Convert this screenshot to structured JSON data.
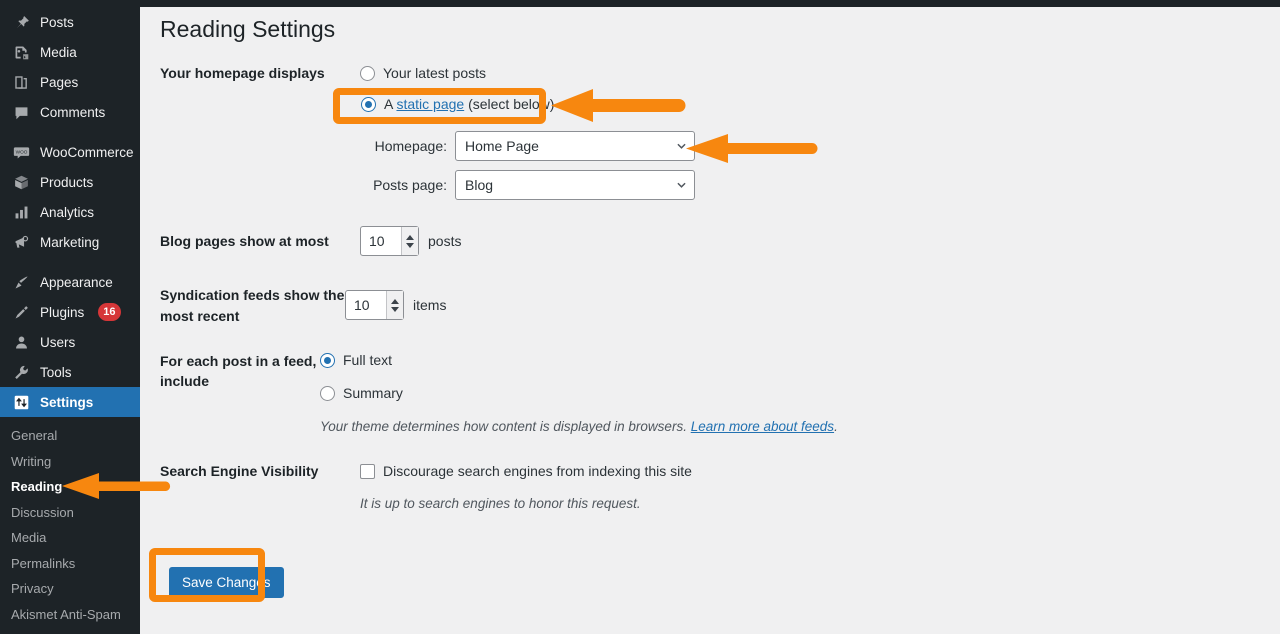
{
  "colors": {
    "sidebar_bg": "#1d2327",
    "accent_blue": "#2271b1",
    "highlight_orange": "#f7870f",
    "badge_red": "#d63638",
    "content_bg": "#f0f0f1"
  },
  "sidebar": {
    "items": [
      {
        "label": "Posts",
        "icon": "pin-icon",
        "separator_after": false
      },
      {
        "label": "Media",
        "icon": "media-icon",
        "separator_after": false
      },
      {
        "label": "Pages",
        "icon": "pages-icon",
        "separator_after": false
      },
      {
        "label": "Comments",
        "icon": "comment-icon",
        "separator_after": true
      },
      {
        "label": "WooCommerce",
        "icon": "woocommerce-icon",
        "separator_after": false
      },
      {
        "label": "Products",
        "icon": "products-icon",
        "separator_after": false
      },
      {
        "label": "Analytics",
        "icon": "analytics-icon",
        "separator_after": false
      },
      {
        "label": "Marketing",
        "icon": "marketing-icon",
        "separator_after": true
      },
      {
        "label": "Appearance",
        "icon": "appearance-icon",
        "separator_after": false
      },
      {
        "label": "Plugins",
        "icon": "plugins-icon",
        "badge": "16",
        "separator_after": false
      },
      {
        "label": "Users",
        "icon": "users-icon",
        "separator_after": false
      },
      {
        "label": "Tools",
        "icon": "tools-icon",
        "separator_after": false
      },
      {
        "label": "Settings",
        "icon": "settings-icon",
        "current": true,
        "separator_after": false
      }
    ],
    "submenu": [
      {
        "label": "General"
      },
      {
        "label": "Writing"
      },
      {
        "label": "Reading",
        "active": true
      },
      {
        "label": "Discussion"
      },
      {
        "label": "Media"
      },
      {
        "label": "Permalinks"
      },
      {
        "label": "Privacy"
      },
      {
        "label": "Akismet Anti-Spam"
      }
    ]
  },
  "page": {
    "title": "Reading Settings"
  },
  "form": {
    "homepage_displays": {
      "label": "Your homepage displays",
      "options": [
        {
          "label": "Your latest posts",
          "checked": false
        },
        {
          "checked": true,
          "prefix": "A ",
          "link": "static page",
          "suffix": " (select below)"
        }
      ],
      "homepage_select": {
        "label": "Homepage:",
        "value": "Home Page"
      },
      "posts_page_select": {
        "label": "Posts page:",
        "value": "Blog"
      }
    },
    "blog_pages": {
      "label": "Blog pages show at most",
      "value": "10",
      "unit": "posts"
    },
    "syndication_feeds": {
      "label": "Syndication feeds show the most recent",
      "value": "10",
      "unit": "items"
    },
    "feed_include": {
      "label": "For each post in a feed, include",
      "options": [
        {
          "label": "Full text",
          "checked": true
        },
        {
          "label": "Summary",
          "checked": false
        }
      ],
      "description_text": "Your theme determines how content is displayed in browsers. ",
      "description_link": "Learn more about feeds",
      "description_end": "."
    },
    "search_visibility": {
      "label": "Search Engine Visibility",
      "checkbox_label": "Discourage search engines from indexing this site",
      "checked": false,
      "description": "It is up to search engines to honor this request."
    },
    "save_button": "Save Changes"
  },
  "annotations": {
    "arrow_static_page": "left-arrow-icon",
    "arrow_homepage": "left-arrow-icon",
    "arrow_reading": "left-arrow-icon",
    "box_static_page": "highlight-box",
    "box_save": "highlight-box"
  }
}
